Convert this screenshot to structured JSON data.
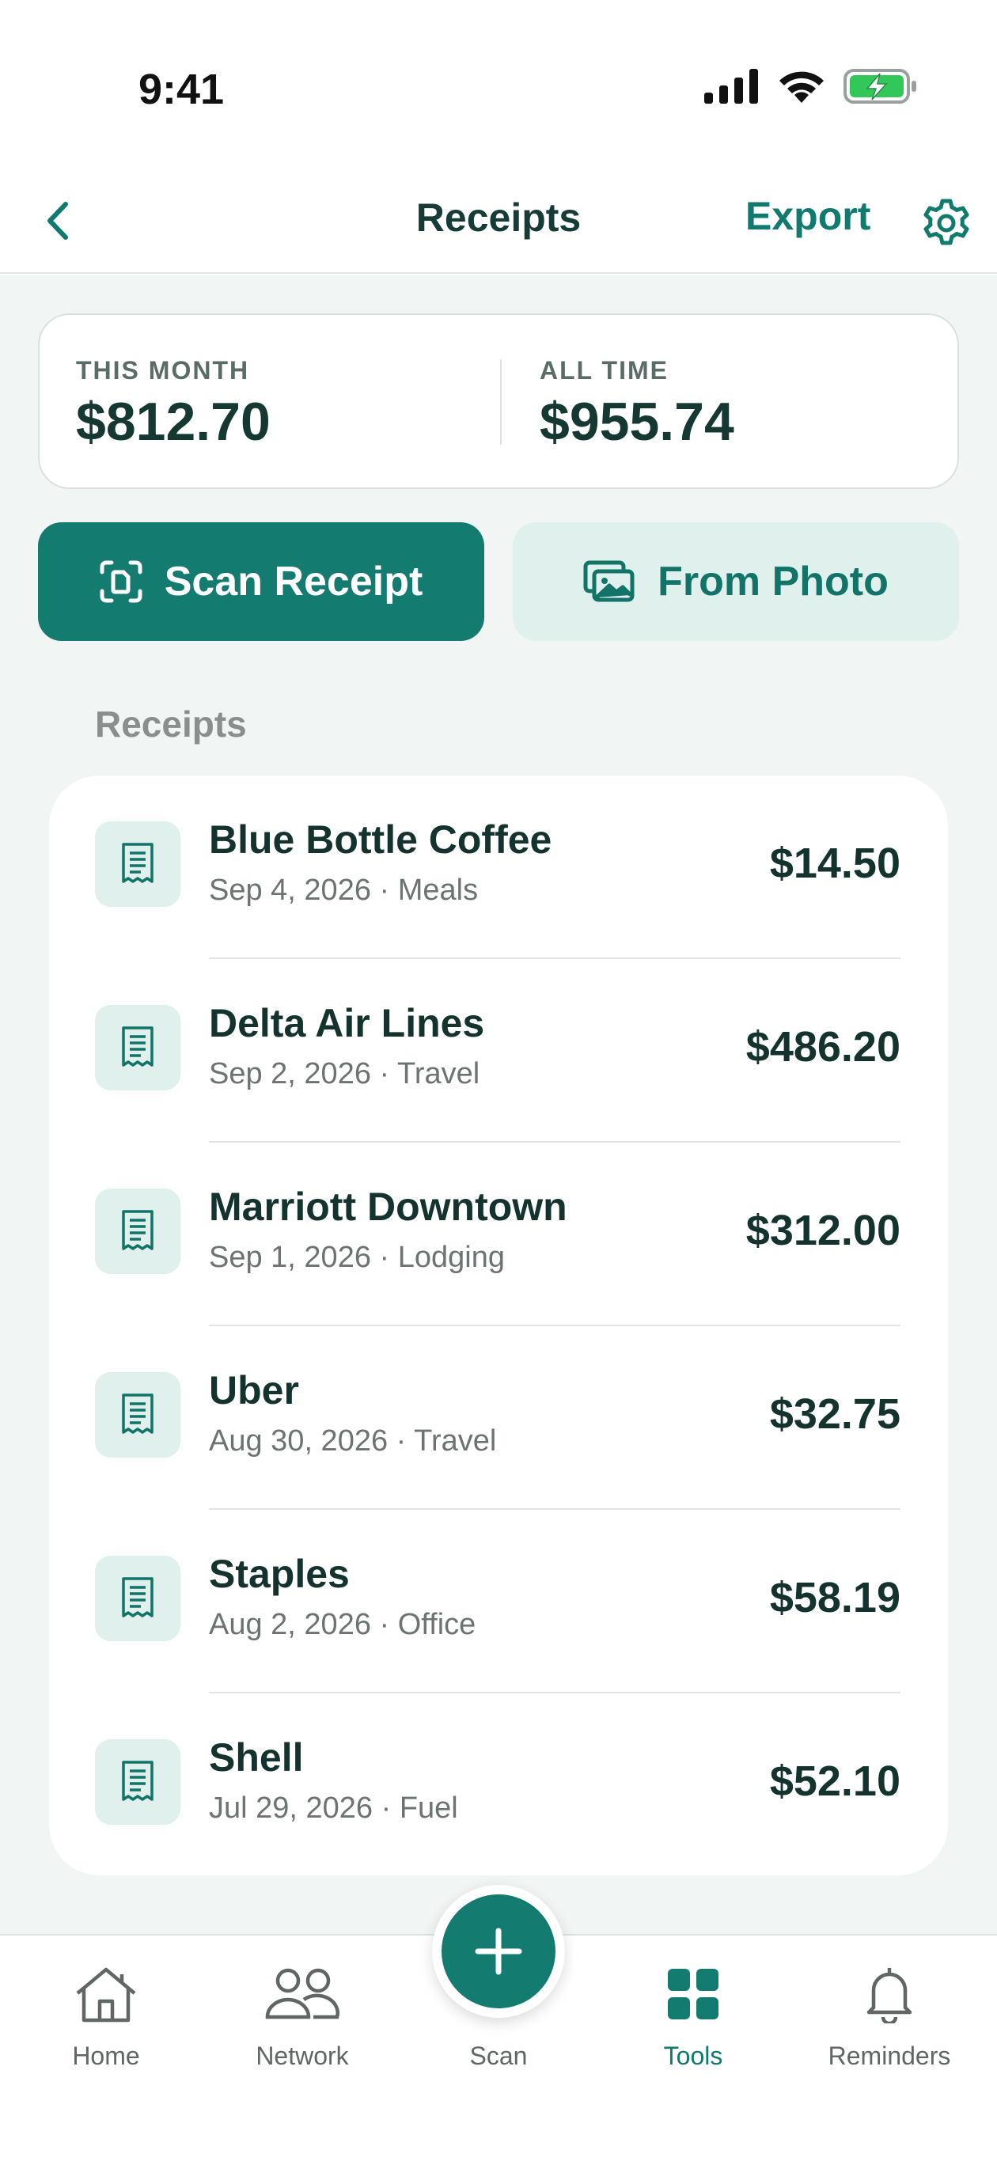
{
  "status_bar": {
    "time": "9:41"
  },
  "nav": {
    "title": "Receipts",
    "export_label": "Export"
  },
  "summary": {
    "this_month_label": "THIS MONTH",
    "this_month_value": "$812.70",
    "all_time_label": "ALL TIME",
    "all_time_value": "$955.74"
  },
  "actions": {
    "scan_label": "Scan Receipt",
    "photo_label": "From Photo"
  },
  "section_label": "Receipts",
  "receipts": [
    {
      "name": "Blue Bottle Coffee",
      "meta": "Sep 4, 2026 · Meals",
      "amount": "$14.50"
    },
    {
      "name": "Delta Air Lines",
      "meta": "Sep 2, 2026 · Travel",
      "amount": "$486.20"
    },
    {
      "name": "Marriott Downtown",
      "meta": "Sep 1, 2026 · Lodging",
      "amount": "$312.00"
    },
    {
      "name": "Uber",
      "meta": "Aug 30, 2026 · Travel",
      "amount": "$32.75"
    },
    {
      "name": "Staples",
      "meta": "Aug 2, 2026 · Office",
      "amount": "$58.19"
    },
    {
      "name": "Shell",
      "meta": "Jul 29, 2026 · Fuel",
      "amount": "$52.10"
    }
  ],
  "tabs": [
    {
      "label": "Home",
      "icon": "home-icon"
    },
    {
      "label": "Network",
      "icon": "people-icon"
    },
    {
      "label": "Scan",
      "icon": "plus-icon"
    },
    {
      "label": "Tools",
      "icon": "grid-icon",
      "active": true
    },
    {
      "label": "Reminders",
      "icon": "bell-icon"
    }
  ],
  "colors": {
    "accent": "#137b6f",
    "accent_soft": "#dff0ed",
    "background": "#f1f5f4"
  }
}
